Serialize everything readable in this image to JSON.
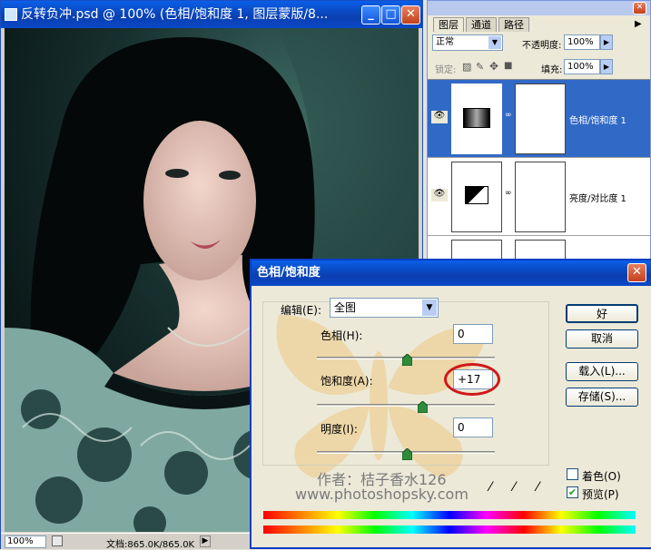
{
  "document": {
    "title": "反转负冲.psd @ 100% (色相/饱和度 1, 图层蒙版/8...",
    "zoom": "100%",
    "doc_size": "文档:865.0K/865.0K"
  },
  "layers_panel": {
    "tabs": [
      "图层",
      "通道",
      "路径"
    ],
    "blend_mode": "正常",
    "opacity_label": "不透明度:",
    "opacity_value": "100%",
    "lock_label": "锁定:",
    "fill_label": "填充:",
    "fill_value": "100%",
    "layers": [
      {
        "name": "色相/饱和度 1",
        "selected": true
      },
      {
        "name": "亮度/对比度 1",
        "selected": false
      }
    ]
  },
  "dialog": {
    "title": "色相/饱和度",
    "edit_label": "编辑(E):",
    "edit_value": "全图",
    "hue_label": "色相(H):",
    "hue_value": "0",
    "saturation_label": "饱和度(A):",
    "saturation_value": "+17",
    "lightness_label": "明度(I):",
    "lightness_value": "0",
    "buttons": {
      "ok": "好",
      "cancel": "取消",
      "load": "载入(L)...",
      "save": "存储(S)..."
    },
    "colorize_label": "着色(O)",
    "colorize_checked": false,
    "preview_label": "预览(P)",
    "preview_checked": true,
    "watermark_author": "作者：桔子香水126",
    "watermark_url": "www.photoshopsky.com",
    "highlight_color": "#d01818"
  }
}
